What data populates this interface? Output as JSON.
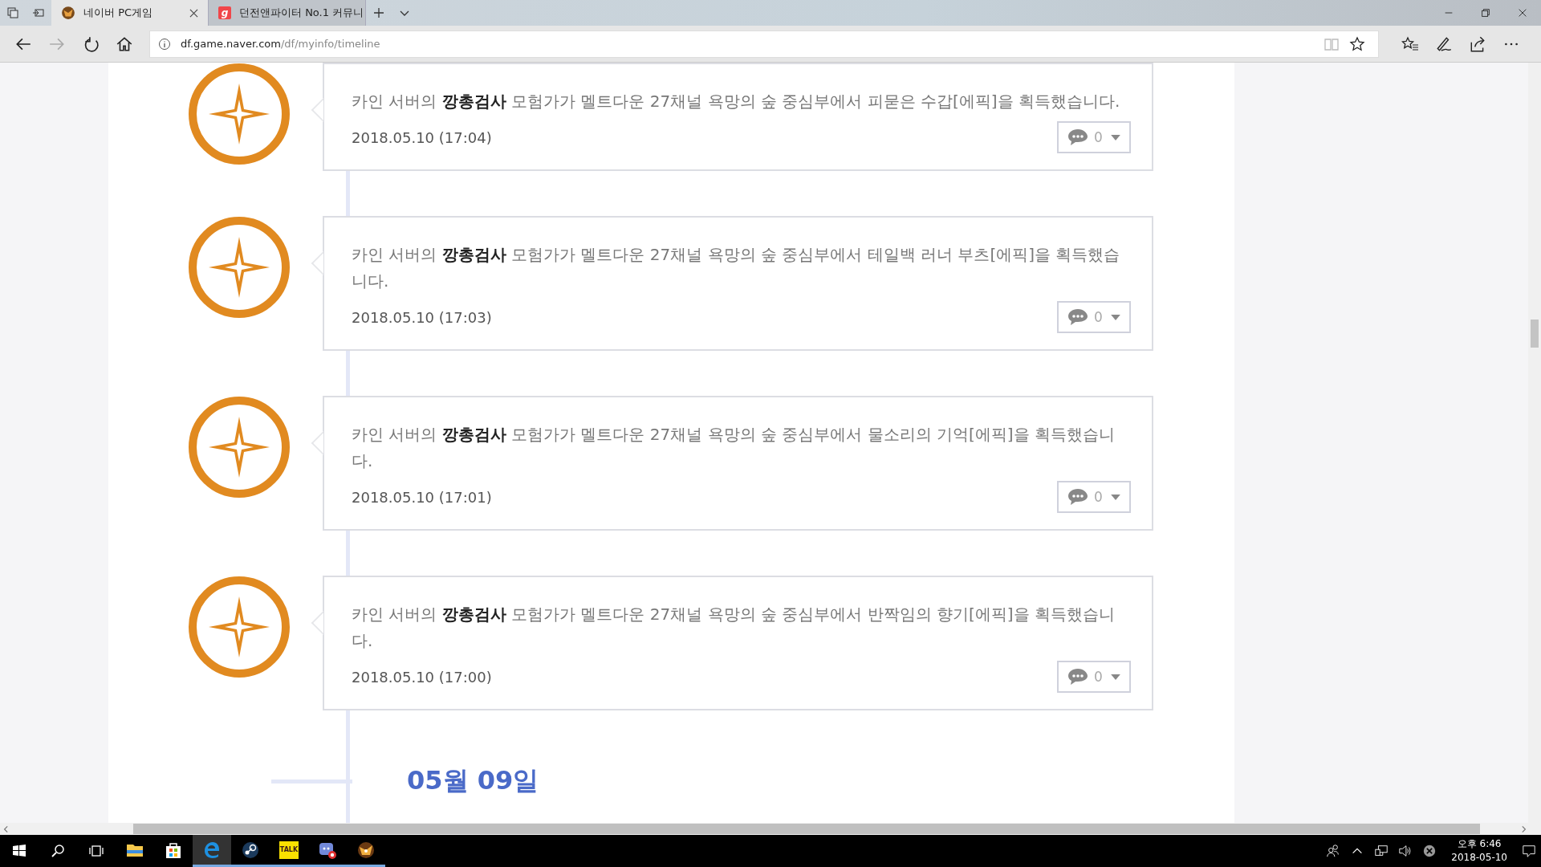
{
  "tabs": [
    {
      "title": "네이버 PC게임",
      "selected": true,
      "kind": "game"
    },
    {
      "title": "던전앤파이터 No.1 커뮤니",
      "selected": false,
      "kind": "g"
    }
  ],
  "tab_icon_letter": "g",
  "address": {
    "domain": "df.game.naver.com",
    "path": "/df/myinfo/timeline"
  },
  "entries": [
    {
      "text": "카인 서버의 **깡총검사** 모험가가 멜트다운 27채널 욕망의 숲 중심부에서 피묻은 수갑[에픽]을 획득했습니다.",
      "date": "2018.05.10 (17:04)",
      "comments": "0"
    },
    {
      "text": "카인 서버의 **깡총검사** 모험가가 멜트다운 27채널 욕망의 숲 중심부에서 테일백 러너 부츠[에픽]을 획득했습니다.",
      "date": "2018.05.10 (17:03)",
      "comments": "0"
    },
    {
      "text": "카인 서버의 **깡총검사** 모험가가 멜트다운 27채널 욕망의 숲 중심부에서 물소리의 기억[에픽]을 획득했습니다.",
      "date": "2018.05.10 (17:01)",
      "comments": "0"
    },
    {
      "text": "카인 서버의 **깡총검사** 모험가가 멜트다운 27채널 욕망의 숲 중심부에서 반짝임의 향기[에픽]을 획득했습니다.",
      "date": "2018.05.10 (17:00)",
      "comments": "0"
    }
  ],
  "day_heading": "05월 09일",
  "taskbar": {
    "apps": [
      {
        "kind": "explorer",
        "active": false
      },
      {
        "kind": "store",
        "active": false
      },
      {
        "kind": "edge",
        "active": true
      },
      {
        "kind": "steam",
        "active": false
      },
      {
        "kind": "talk",
        "active": false,
        "label": "TALK"
      },
      {
        "kind": "discord",
        "active": false
      },
      {
        "kind": "game",
        "active": false
      }
    ],
    "time": "오후 6:46",
    "date": "2018-05-10"
  }
}
